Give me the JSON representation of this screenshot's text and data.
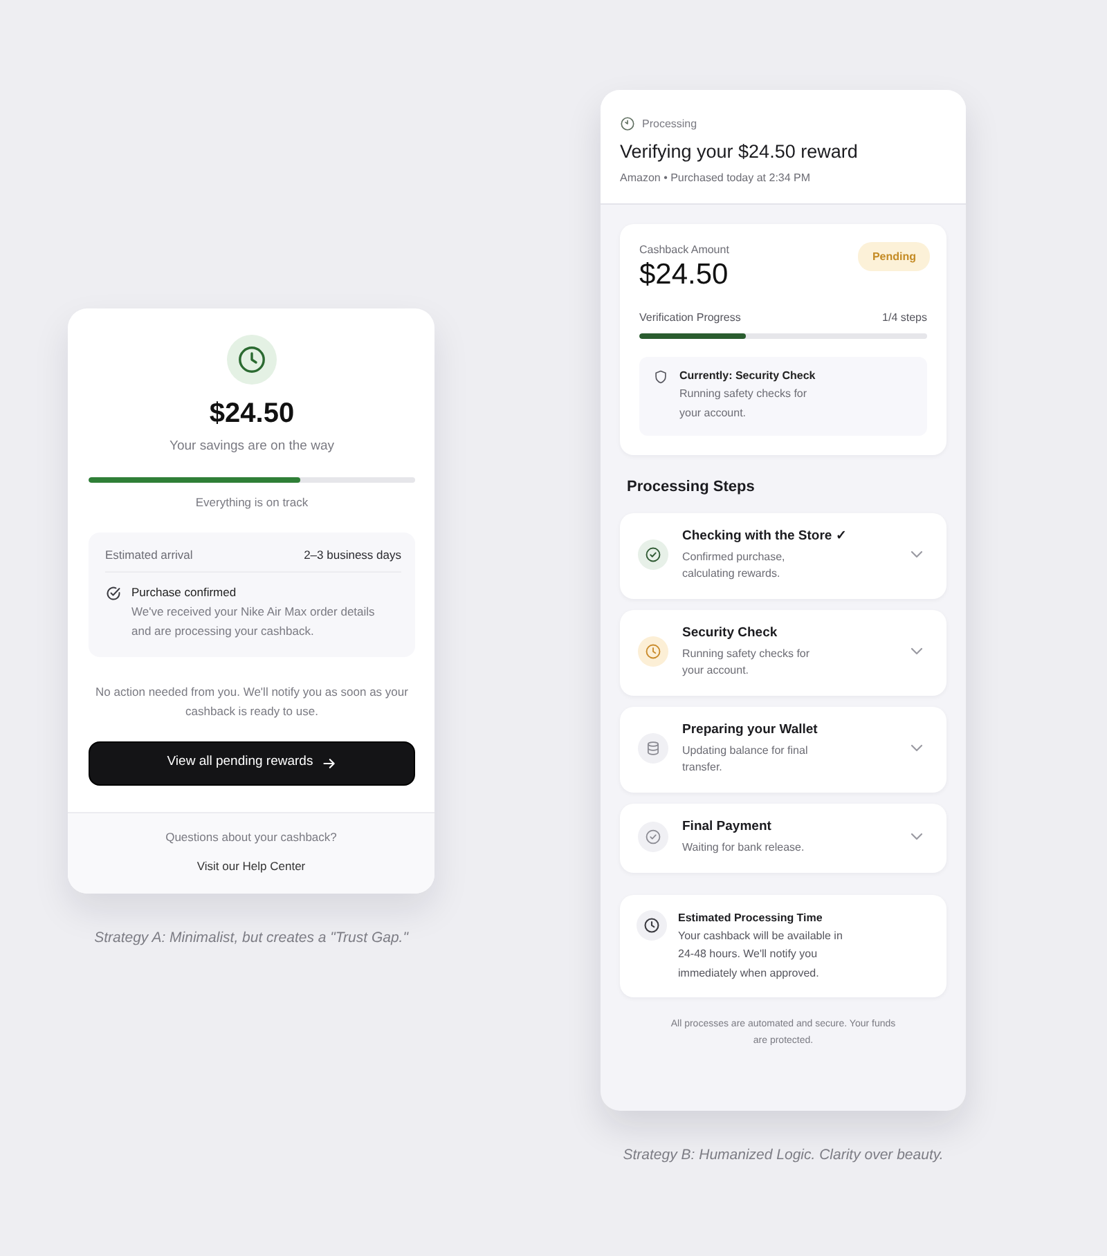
{
  "left_panel": {
    "amount": "$24.50",
    "subtitle": "Your savings are on the way",
    "progress": {
      "level": 0.65
    },
    "progress_note": "Everything is on track",
    "details": {
      "label": "Estimated arrival",
      "value": "2–3 business days",
      "event_title": "Purchase confirmed",
      "event_text": "We've received your Nike Air Max order details and are processing your cashback."
    },
    "notice": "No action needed from you. We'll notify you as soon as your cashback is ready to use.",
    "button": "View all pending rewards",
    "footer_question": "Questions about your cashback?",
    "footer_link": "Visit our Help Center",
    "caption": "Strategy A: Minimalist, but creates a \"Trust Gap.\""
  },
  "right_panel": {
    "header": {
      "status": "Processing",
      "title": "Verifying your $24.50 reward",
      "meta": "Amazon • Purchased today at 2:34 PM"
    },
    "summary": {
      "label": "Cashback Amount",
      "amount": "$24.50",
      "badge": "Pending",
      "progress_label": "Verification Progress",
      "progress_count": "1/4 steps",
      "progress": {
        "level": 0.37
      },
      "current": {
        "title": "Currently: Security Check",
        "text": "Running safety checks for your account."
      }
    },
    "steps_title": "Processing Steps",
    "steps": [
      {
        "kind": "store",
        "completed": true,
        "active": false,
        "title": "Checking with the Store ✓",
        "text": "Confirmed purchase, calculating rewards.",
        "expanded": false
      },
      {
        "kind": "security",
        "completed": false,
        "active": true,
        "title": "Security Check",
        "text": "Running safety checks for your account.",
        "expanded": false
      },
      {
        "kind": "wallet",
        "completed": false,
        "active": false,
        "title": "Preparing your Wallet",
        "text": "Updating balance for final transfer.",
        "expanded": false
      },
      {
        "kind": "payment",
        "completed": false,
        "active": false,
        "title": "Final Payment",
        "text": "Waiting for bank release.",
        "expanded": false
      }
    ],
    "estimate": {
      "title": "Estimated Processing Time",
      "text": "Your cashback will be available in 24-48 hours. We'll notify you immediately when approved."
    },
    "footnote": "All processes are automated and secure. Your funds are protected.",
    "caption": "Strategy B: Humanized Logic. Clarity over beauty."
  }
}
